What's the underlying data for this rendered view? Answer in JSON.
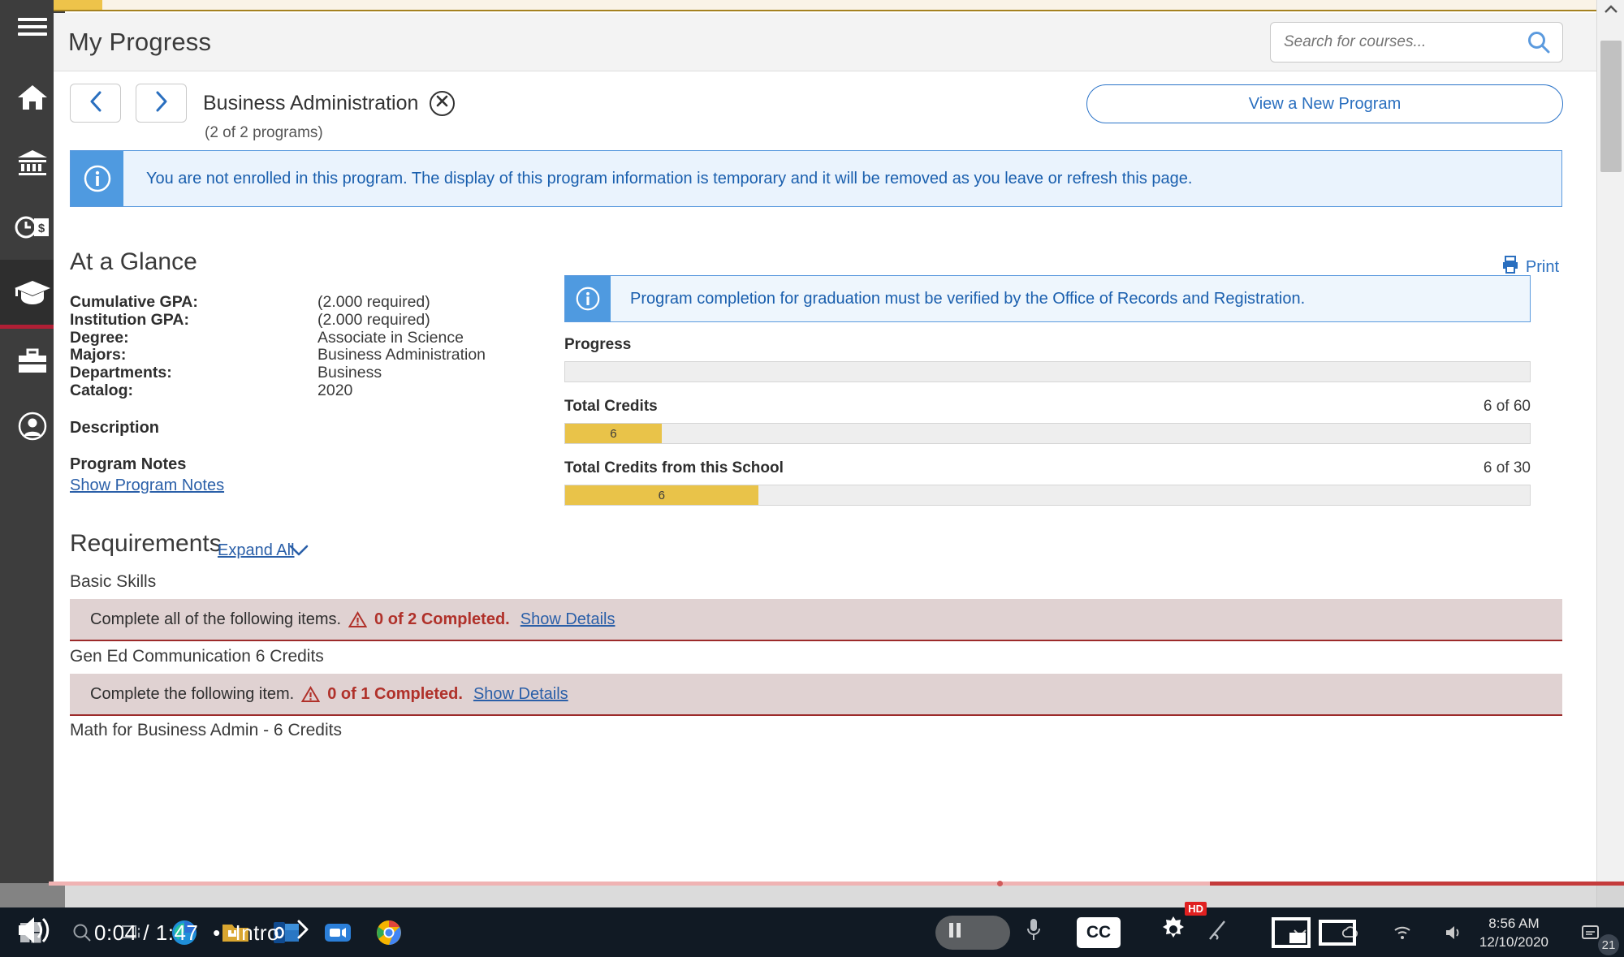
{
  "header": {
    "title": "My Progress",
    "search_placeholder": "Search for courses...",
    "search_value": ""
  },
  "program_nav": {
    "prev_label": "‹",
    "next_label": "›",
    "program_name": "Business Administration",
    "program_count": "(2 of 2 programs)",
    "close_label": "×",
    "view_new_program": "View a New Program"
  },
  "notices": {
    "enrollment": "You are not enrolled in this program. The display of this program information is temporary and it will be removed as you leave or refresh this page.",
    "graduation": "Program completion for graduation must be verified by the Office of Records and Registration."
  },
  "at_a_glance": {
    "heading": "At a Glance",
    "print_label": "Print",
    "facts": [
      {
        "label": "Cumulative GPA:",
        "value": "(2.000 required)"
      },
      {
        "label": "Institution GPA:",
        "value": "(2.000 required)"
      },
      {
        "label": "Degree:",
        "value": "Associate in Science"
      },
      {
        "label": "Majors:",
        "value": "Business Administration"
      },
      {
        "label": "Departments:",
        "value": "Business"
      },
      {
        "label": "Catalog:",
        "value": "2020"
      }
    ],
    "description_heading": "Description",
    "description_value": "",
    "program_notes_heading": "Program Notes",
    "program_notes_link": "Show Program Notes"
  },
  "progress_section": {
    "progress_label": "Progress",
    "progress_value": "",
    "progress_percent": 0,
    "bars": [
      {
        "label": "Total Credits",
        "right": "6 of 60",
        "fill_text": "6",
        "percent": 10
      },
      {
        "label": "Total Credits from this School",
        "right": "6 of 30",
        "fill_text": "6",
        "percent": 20
      }
    ]
  },
  "requirements": {
    "heading": "Requirements",
    "expand_all": "Expand All",
    "groups": [
      {
        "title": "Basic Skills",
        "row_text": "Complete all of the following items.",
        "count": "0 of 2 Completed.",
        "details": "Show Details"
      },
      {
        "title": "Gen Ed Communication 6 Credits",
        "row_text": "Complete the following item.",
        "count": "0 of 1 Completed.",
        "details": "Show Details"
      },
      {
        "title": "Math for Business Admin - 6 Credits",
        "row_text": "",
        "count": "",
        "details": ""
      }
    ]
  },
  "sidebar": {
    "items": [
      {
        "name": "home",
        "label": "Home"
      },
      {
        "name": "institution",
        "label": "Institution"
      },
      {
        "name": "financials",
        "label": "Financials"
      },
      {
        "name": "academics",
        "label": "Academics",
        "active": true
      },
      {
        "name": "resources",
        "label": "Resources"
      },
      {
        "name": "account",
        "label": "Account"
      }
    ]
  },
  "video_player": {
    "time_current": "0:04",
    "time_total": "1:47",
    "chapter": "Intro",
    "separator": "•",
    "time_display": "0:04 / 1:47",
    "cc_label": "CC",
    "hd_badge": "HD"
  },
  "taskbar": {
    "clock_time": "8:56 AM",
    "clock_date": "12/10/2020",
    "notification_count": "21",
    "apps": [
      "start",
      "search",
      "task-view",
      "edge",
      "file-explorer",
      "outlook",
      "zoom",
      "chrome"
    ]
  },
  "colors": {
    "accent_gold": "#e9c349",
    "link_blue": "#2a5fa8",
    "info_blue": "#4f9ae0",
    "alert_red": "#b0312a",
    "rail_dark": "#3d3d3d",
    "active_underline": "#b01f35"
  }
}
